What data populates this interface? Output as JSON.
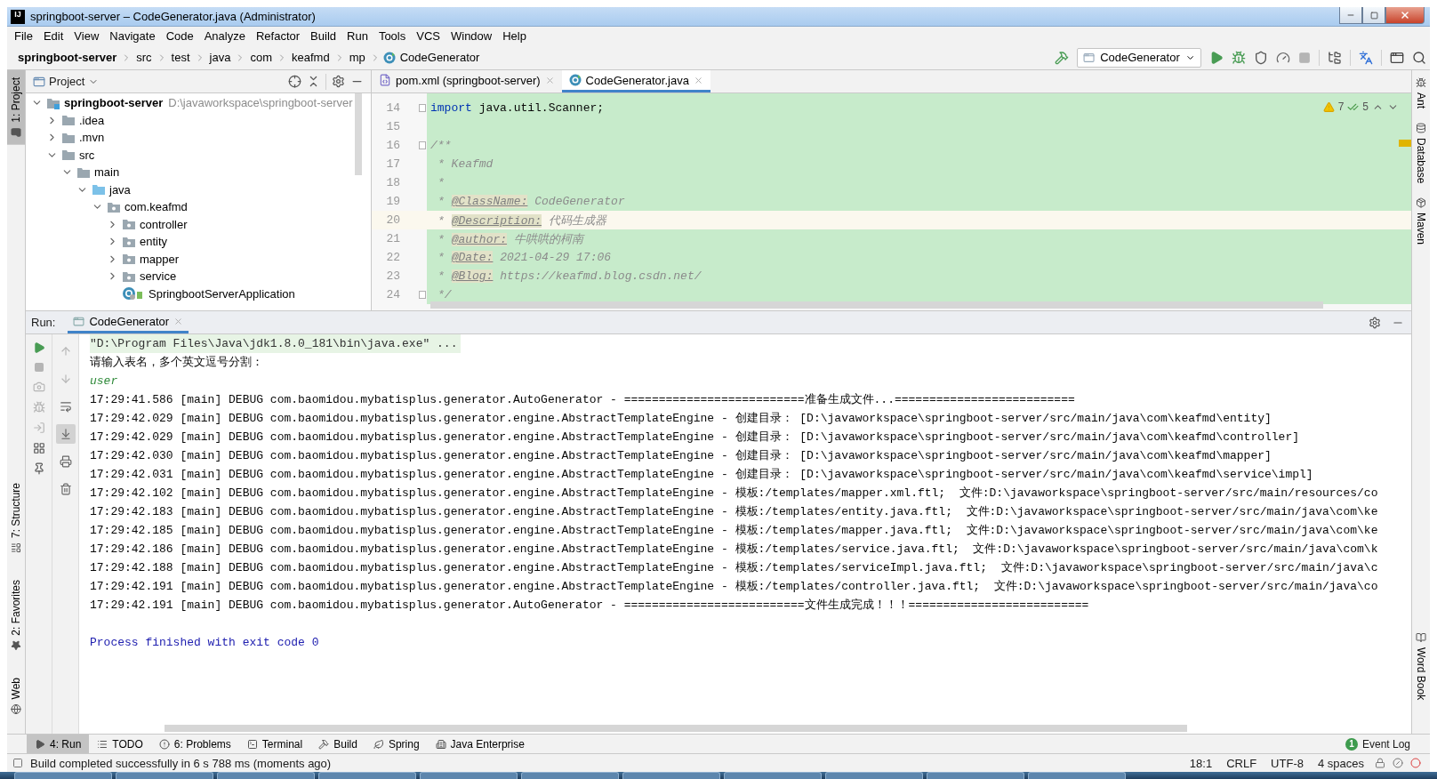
{
  "window": {
    "logo": "IJ",
    "title": "springboot-server – CodeGenerator.java (Administrator)"
  },
  "menu": [
    "File",
    "Edit",
    "View",
    "Navigate",
    "Code",
    "Analyze",
    "Refactor",
    "Build",
    "Run",
    "Tools",
    "VCS",
    "Window",
    "Help"
  ],
  "breadcrumb": [
    {
      "label": "springboot-server",
      "kind": "project"
    },
    {
      "label": "src",
      "kind": "folder"
    },
    {
      "label": "test",
      "kind": "folder"
    },
    {
      "label": "java",
      "kind": "folder"
    },
    {
      "label": "com",
      "kind": "folder"
    },
    {
      "label": "keafmd",
      "kind": "folder"
    },
    {
      "label": "mp",
      "kind": "folder"
    },
    {
      "label": "CodeGenerator",
      "kind": "class"
    }
  ],
  "toolbar": [
    {
      "kind": "build",
      "disabled": false
    },
    {
      "kind": "config",
      "label": "CodeGenerator",
      "disabled": false
    },
    {
      "kind": "run",
      "disabled": false
    },
    {
      "kind": "debug",
      "disabled": false
    },
    {
      "kind": "coverage",
      "disabled": false
    },
    {
      "kind": "profile",
      "disabled": false
    },
    {
      "kind": "stop",
      "disabled": true
    },
    {
      "kind": "structure",
      "disabled": false
    },
    {
      "kind": "translate",
      "disabled": false
    },
    {
      "kind": "terminal",
      "disabled": false
    },
    {
      "kind": "search",
      "disabled": false
    }
  ],
  "left_stripe": {
    "top": [
      {
        "label": "1: Project",
        "kind": "project",
        "selected": true
      }
    ],
    "bottom": [
      {
        "label": "7: Structure",
        "kind": "structure",
        "selected": false
      },
      {
        "label": "2: Favorites",
        "kind": "favorites",
        "selected": false
      },
      {
        "label": "Web",
        "kind": "web",
        "selected": false
      }
    ]
  },
  "right_stripe": {
    "top": [
      {
        "label": "Ant",
        "kind": "ant"
      },
      {
        "label": "Database",
        "kind": "database"
      },
      {
        "label": "Maven",
        "kind": "maven"
      }
    ],
    "bottom": [
      {
        "label": "Word Book",
        "kind": "book"
      }
    ]
  },
  "project_panel": {
    "title": "Project",
    "tree": [
      {
        "label": "springboot-server",
        "path": "D:\\javaworkspace\\springboot-server",
        "kind": "module",
        "expanded": true,
        "children": [
          {
            "label": ".idea",
            "kind": "folder",
            "expanded": false
          },
          {
            "label": ".mvn",
            "kind": "folder",
            "expanded": false
          },
          {
            "label": "src",
            "kind": "folder",
            "expanded": true,
            "children": [
              {
                "label": "main",
                "kind": "folder",
                "expanded": true,
                "children": [
                  {
                    "label": "java",
                    "kind": "source-folder",
                    "expanded": true,
                    "children": [
                      {
                        "label": "com.keafmd",
                        "kind": "package",
                        "expanded": true,
                        "children": [
                          {
                            "label": "controller",
                            "kind": "package",
                            "expanded": false
                          },
                          {
                            "label": "entity",
                            "kind": "package",
                            "expanded": false
                          },
                          {
                            "label": "mapper",
                            "kind": "package",
                            "expanded": false
                          },
                          {
                            "label": "service",
                            "kind": "package",
                            "expanded": false
                          },
                          {
                            "label": "SpringbootServerApplication",
                            "kind": "app-class"
                          }
                        ]
                      }
                    ]
                  }
                ]
              }
            ]
          }
        ]
      }
    ]
  },
  "editor": {
    "tabs": [
      {
        "label": "pom.xml (springboot-server)",
        "kind": "maven",
        "selected": false
      },
      {
        "label": "CodeGenerator.java",
        "kind": "class",
        "selected": true
      }
    ],
    "inspections": {
      "warnings": "7",
      "typos": "5"
    },
    "lines": [
      {
        "number": "14",
        "kind": "import",
        "keyword": "import",
        "text": "java.util.Scanner;",
        "fold": true,
        "current": false
      },
      {
        "number": "15",
        "kind": "blank",
        "fold": false,
        "current": false
      },
      {
        "number": "16",
        "kind": "doc-open",
        "text": "/**",
        "fold": true,
        "current": false
      },
      {
        "number": "17",
        "kind": "doc",
        "text": "* Keafmd",
        "fold": false,
        "current": false
      },
      {
        "number": "18",
        "kind": "doc",
        "text": "*",
        "fold": false,
        "current": false
      },
      {
        "number": "19",
        "kind": "doc-tag",
        "prefix": "*",
        "tag": "@ClassName:",
        "text": "CodeGenerator",
        "fold": false,
        "current": false
      },
      {
        "number": "20",
        "kind": "doc-tag",
        "prefix": "*",
        "tag": "@Description:",
        "text": "代码生成器",
        "fold": false,
        "current": true
      },
      {
        "number": "21",
        "kind": "doc-tag",
        "prefix": "*",
        "tag": "@author:",
        "text": "牛哄哄的柯南",
        "fold": false,
        "current": false
      },
      {
        "number": "22",
        "kind": "doc-tag",
        "prefix": "*",
        "tag": "@Date:",
        "text": "2021-04-29 17:06",
        "fold": false,
        "current": false
      },
      {
        "number": "23",
        "kind": "doc-tag",
        "prefix": "*",
        "tag": "@Blog:",
        "text": "https://keafmd.blog.csdn.net/",
        "fold": false,
        "current": false
      },
      {
        "number": "24",
        "kind": "doc",
        "text": "*/",
        "fold": true,
        "current": false
      }
    ]
  },
  "run_panel": {
    "label": "Run:",
    "tabs": [
      {
        "label": "CodeGenerator",
        "selected": true
      }
    ],
    "left_tools": [
      {
        "kind": "rerun",
        "disabled": false
      },
      {
        "kind": "stop",
        "disabled": true
      },
      {
        "kind": "camera",
        "disabled": true
      },
      {
        "kind": "debug",
        "disabled": true
      },
      {
        "kind": "exit",
        "disabled": true
      },
      {
        "kind": "layout",
        "disabled": false
      },
      {
        "kind": "pin",
        "disabled": false
      }
    ],
    "right_tools": [
      {
        "kind": "up",
        "selected": false
      },
      {
        "kind": "down",
        "selected": false
      },
      {
        "kind": "wrap",
        "selected": false
      },
      {
        "kind": "scroll-end",
        "selected": true
      },
      {
        "kind": "print",
        "selected": false
      },
      {
        "kind": "clear",
        "selected": false
      }
    ],
    "console": [
      {
        "kind": "command",
        "text": "\"D:\\Program Files\\Java\\jdk1.8.0_181\\bin\\java.exe\" ..."
      },
      {
        "kind": "prompt",
        "text": "请输入表名，多个英文逗号分割："
      },
      {
        "kind": "input",
        "text": "user"
      },
      {
        "kind": "log",
        "text": "17:29:41.586 [main] DEBUG com.baomidou.mybatisplus.generator.AutoGenerator - ==========================准备生成文件...=========================="
      },
      {
        "kind": "log",
        "text": "17:29:42.029 [main] DEBUG com.baomidou.mybatisplus.generator.engine.AbstractTemplateEngine - 创建目录： [D:\\javaworkspace\\springboot-server/src/main/java\\com\\keafmd\\entity]"
      },
      {
        "kind": "log",
        "text": "17:29:42.029 [main] DEBUG com.baomidou.mybatisplus.generator.engine.AbstractTemplateEngine - 创建目录： [D:\\javaworkspace\\springboot-server/src/main/java\\com\\keafmd\\controller]"
      },
      {
        "kind": "log",
        "text": "17:29:42.030 [main] DEBUG com.baomidou.mybatisplus.generator.engine.AbstractTemplateEngine - 创建目录： [D:\\javaworkspace\\springboot-server/src/main/java\\com\\keafmd\\mapper]"
      },
      {
        "kind": "log",
        "text": "17:29:42.031 [main] DEBUG com.baomidou.mybatisplus.generator.engine.AbstractTemplateEngine - 创建目录： [D:\\javaworkspace\\springboot-server/src/main/java\\com\\keafmd\\service\\impl]"
      },
      {
        "kind": "log",
        "text": "17:29:42.102 [main] DEBUG com.baomidou.mybatisplus.generator.engine.AbstractTemplateEngine - 模板:/templates/mapper.xml.ftl;  文件:D:\\javaworkspace\\springboot-server/src/main/resources/co"
      },
      {
        "kind": "log",
        "text": "17:29:42.183 [main] DEBUG com.baomidou.mybatisplus.generator.engine.AbstractTemplateEngine - 模板:/templates/entity.java.ftl;  文件:D:\\javaworkspace\\springboot-server/src/main/java\\com\\ke"
      },
      {
        "kind": "log",
        "text": "17:29:42.185 [main] DEBUG com.baomidou.mybatisplus.generator.engine.AbstractTemplateEngine - 模板:/templates/mapper.java.ftl;  文件:D:\\javaworkspace\\springboot-server/src/main/java\\com\\ke"
      },
      {
        "kind": "log",
        "text": "17:29:42.186 [main] DEBUG com.baomidou.mybatisplus.generator.engine.AbstractTemplateEngine - 模板:/templates/service.java.ftl;  文件:D:\\javaworkspace\\springboot-server/src/main/java\\com\\k"
      },
      {
        "kind": "log",
        "text": "17:29:42.188 [main] DEBUG com.baomidou.mybatisplus.generator.engine.AbstractTemplateEngine - 模板:/templates/serviceImpl.java.ftl;  文件:D:\\javaworkspace\\springboot-server/src/main/java\\c"
      },
      {
        "kind": "log",
        "text": "17:29:42.191 [main] DEBUG com.baomidou.mybatisplus.generator.engine.AbstractTemplateEngine - 模板:/templates/controller.java.ftl;  文件:D:\\javaworkspace\\springboot-server/src/main/java\\co"
      },
      {
        "kind": "log",
        "text": "17:29:42.191 [main] DEBUG com.baomidou.mybatisplus.generator.AutoGenerator - ==========================文件生成完成！！！=========================="
      },
      {
        "kind": "exit",
        "text": "Process finished with exit code 0"
      }
    ]
  },
  "bottom_tools": [
    {
      "label": "4: Run",
      "kind": "run",
      "selected": true
    },
    {
      "label": "TODO",
      "kind": "todo",
      "selected": false
    },
    {
      "label": "6: Problems",
      "kind": "problems",
      "selected": false
    },
    {
      "label": "Terminal",
      "kind": "terminal",
      "selected": false
    },
    {
      "label": "Build",
      "kind": "build",
      "selected": false
    },
    {
      "label": "Spring",
      "kind": "spring",
      "selected": false
    },
    {
      "label": "Java Enterprise",
      "kind": "enterprise",
      "selected": false
    }
  ],
  "event_log": {
    "label": "Event Log",
    "count": "1"
  },
  "status_bar": {
    "message": "Build completed successfully in 6 s 788 ms (moments ago)",
    "items": [
      "18:1",
      "CRLF",
      "UTF-8",
      "4 spaces"
    ]
  }
}
